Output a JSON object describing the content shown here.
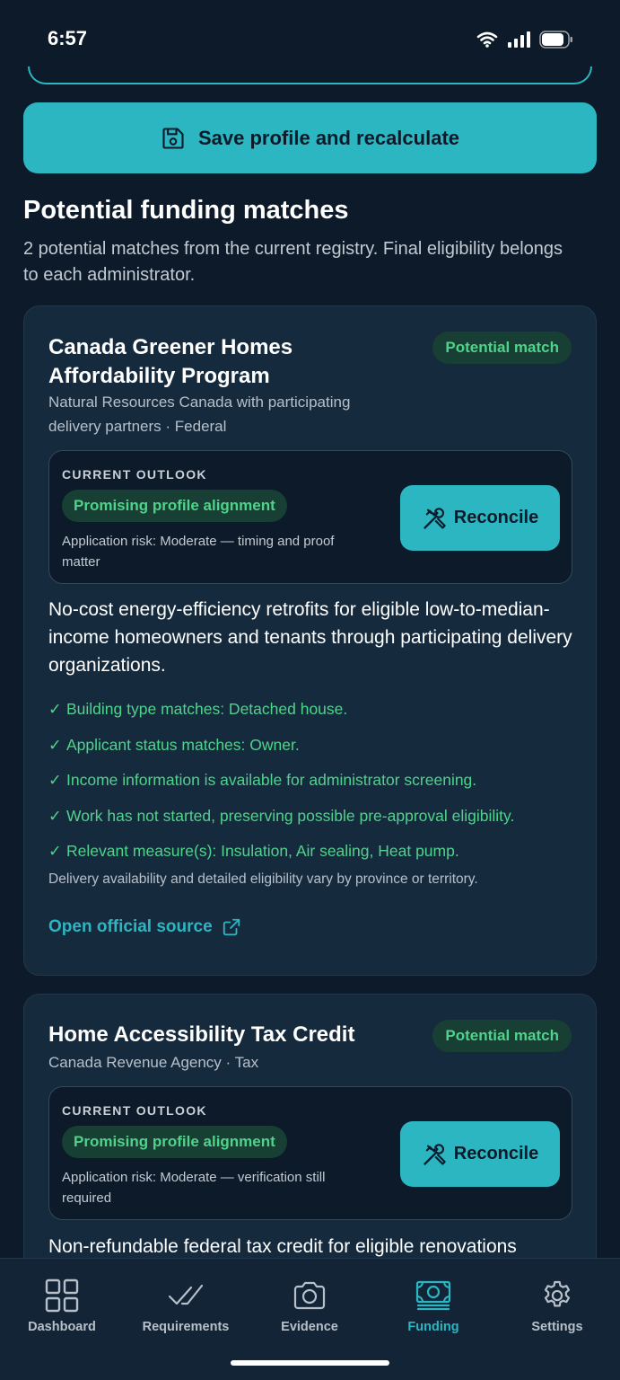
{
  "status_bar": {
    "time": "6:57"
  },
  "save_button": {
    "label": "Save profile and recalculate"
  },
  "section": {
    "title": "Potential funding matches",
    "subtitle": "2 potential matches from the current registry. Final eligibility belongs to each administrator."
  },
  "matches": [
    {
      "title": "Canada Greener Homes Affordability Program",
      "badge": "Potential match",
      "meta": "Natural Resources Canada with participating delivery partners · Federal",
      "outlook_label": "CURRENT OUTLOOK",
      "outlook_status": "Promising profile alignment",
      "risk": "Application risk: Moderate — timing and proof matter",
      "reconcile_label": "Reconcile",
      "description": "No-cost energy-efficiency retrofits for eligible low-to-median-income homeowners and tenants through participating delivery organizations.",
      "checks": [
        "Building type matches: Detached house.",
        "Applicant status matches: Owner.",
        "Income information is available for administrator screening.",
        "Work has not started, preserving possible pre-approval eligibility.",
        "Relevant measure(s): Insulation, Air sealing, Heat pump."
      ],
      "note": "Delivery availability and detailed eligibility vary by province or territory.",
      "source_label": "Open official source"
    },
    {
      "title": "Home Accessibility Tax Credit",
      "badge": "Potential match",
      "meta": "Canada Revenue Agency · Tax",
      "outlook_label": "CURRENT OUTLOOK",
      "outlook_status": "Promising profile alignment",
      "risk": "Application risk: Moderate — verification still required",
      "reconcile_label": "Reconcile",
      "description": "Non-refundable federal tax credit for eligible renovations"
    }
  ],
  "check_symbol": "✓",
  "nav": [
    {
      "label": "Dashboard",
      "icon": "grid-icon",
      "active": false
    },
    {
      "label": "Requirements",
      "icon": "double-check-icon",
      "active": false
    },
    {
      "label": "Evidence",
      "icon": "camera-icon",
      "active": false
    },
    {
      "label": "Funding",
      "icon": "money-icon",
      "active": true
    },
    {
      "label": "Settings",
      "icon": "gear-icon",
      "active": false
    }
  ],
  "colors": {
    "background": "#0c1a29",
    "card": "#162a3d",
    "accent": "#2bb6c2",
    "success": "#4fd38b",
    "success_bg": "#183f33"
  }
}
